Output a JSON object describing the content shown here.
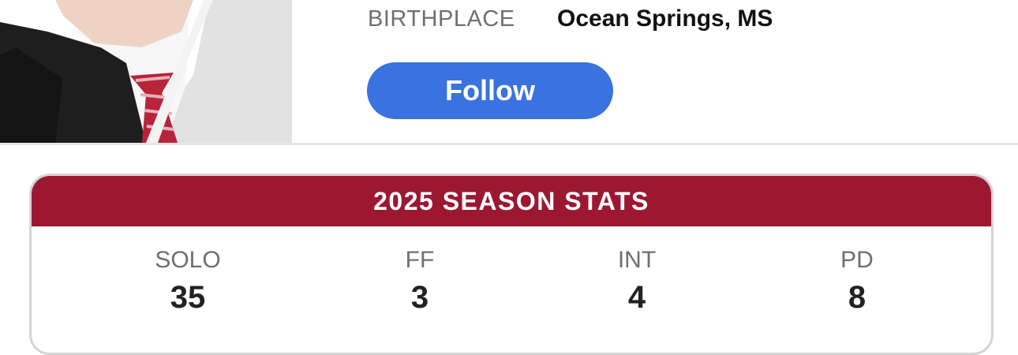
{
  "profile": {
    "bio": {
      "birthplace_label": "BIRTHPLACE",
      "birthplace_value": "Ocean Springs, MS"
    },
    "follow_label": "Follow"
  },
  "season_stats": {
    "title": "2025 SEASON STATS",
    "stats": [
      {
        "label": "SOLO",
        "value": "35"
      },
      {
        "label": "FF",
        "value": "3"
      },
      {
        "label": "INT",
        "value": "4"
      },
      {
        "label": "PD",
        "value": "8"
      }
    ]
  },
  "colors": {
    "accent_crimson": "#9c1831",
    "follow_blue": "#3a72e0"
  }
}
